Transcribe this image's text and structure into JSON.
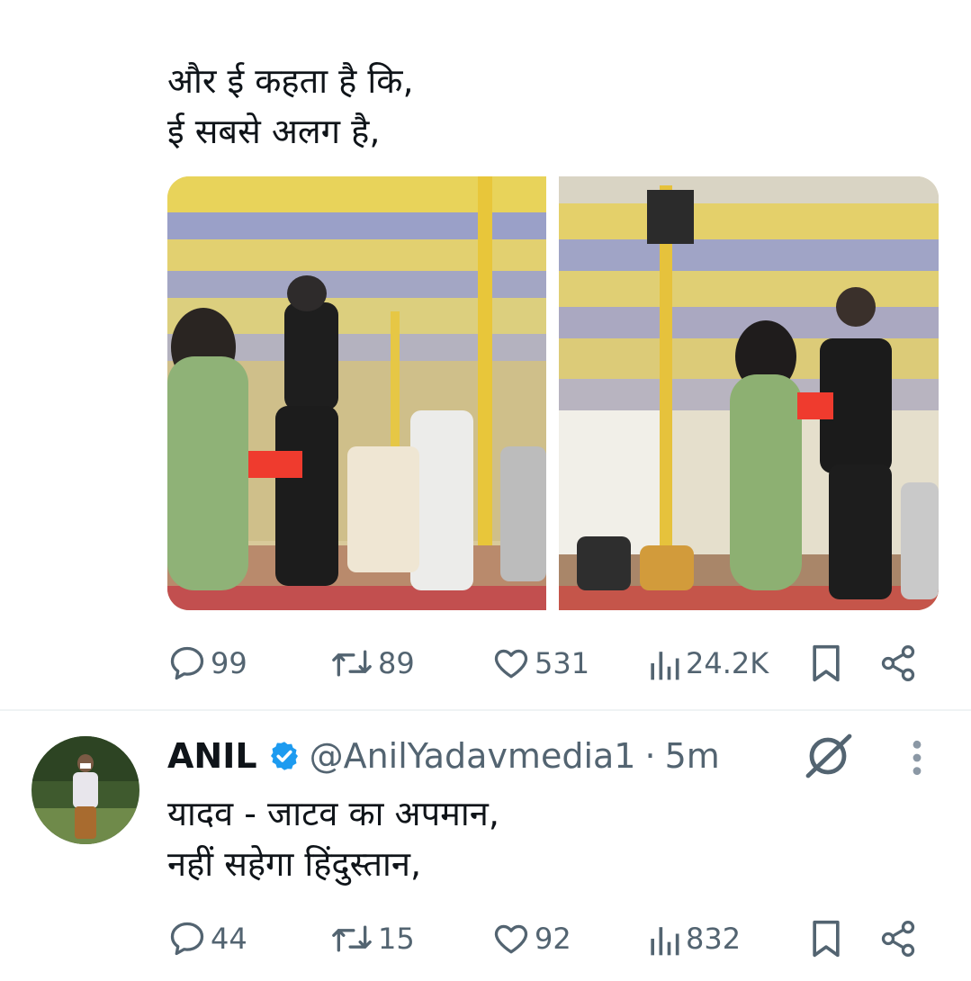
{
  "tweet": {
    "text": "और ई कहता है कि,\nई सबसे अलग है,",
    "media": [
      {
        "icon": "stage-dance-photo"
      },
      {
        "icon": "stage-dance-photo"
      }
    ],
    "actions": {
      "replies": "99",
      "reposts": "89",
      "likes": "531",
      "views": "24.2K"
    }
  },
  "reply": {
    "name": "ANIL",
    "handle": "@AnilYadavmedia1",
    "separator": "·",
    "time": "5m",
    "text": "यादव - जाटव का अपमान,\nनहीं सहेगा हिंदुस्तान,",
    "actions": {
      "replies": "44",
      "reposts": "15",
      "likes": "92",
      "views": "832"
    }
  },
  "colors": {
    "text": "#0f1419",
    "secondary": "#536471",
    "verified": "#1d9bf0",
    "divider": "#eff3f4"
  }
}
